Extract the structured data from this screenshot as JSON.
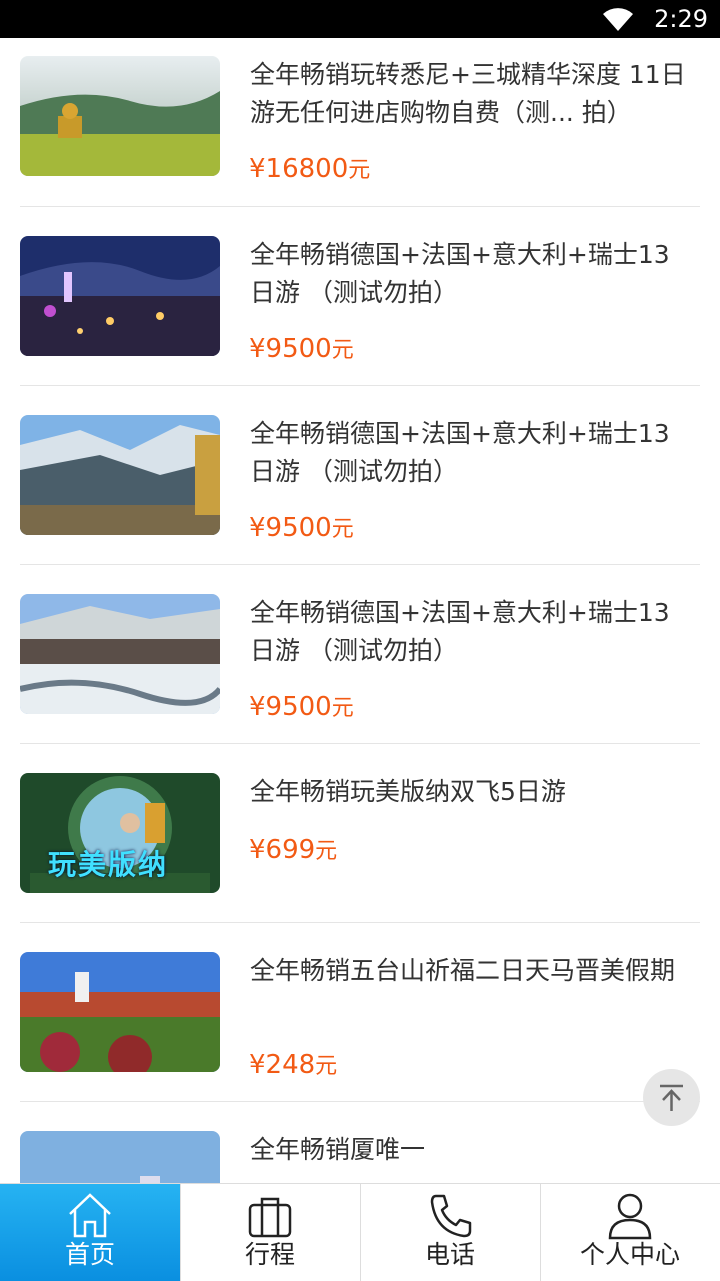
{
  "status_bar": {
    "time": "2:29",
    "wifi_icon": "wifi-icon"
  },
  "products": [
    {
      "title": "全年畅销玩转悉尼+三城精华深度 11日游无任何进店购物自费（测... 拍）",
      "price": "¥16800",
      "unit": "元"
    },
    {
      "title": "全年畅销德国+法国+意大利+瑞士13日游 （测试勿拍）",
      "price": "¥9500",
      "unit": "元"
    },
    {
      "title": "全年畅销德国+法国+意大利+瑞士13日游 （测试勿拍）",
      "price": "¥9500",
      "unit": "元"
    },
    {
      "title": "全年畅销德国+法国+意大利+瑞士13日游 （测试勿拍）",
      "price": "¥9500",
      "unit": "元"
    },
    {
      "title": "全年畅销玩美版纳双飞5日游",
      "price": "¥699",
      "unit": "元"
    },
    {
      "title": "全年畅销五台山祈福二日天马晋美假期",
      "price": "¥248",
      "unit": "元"
    },
    {
      "title": "全年畅销厦唯一",
      "price": "",
      "unit": ""
    }
  ],
  "thumb_caption": "玩美版纳",
  "back_to_top_icon": "arrow-up-to-top-icon",
  "tabs": [
    {
      "label": "首页",
      "icon": "home-icon",
      "active": true
    },
    {
      "label": "行程",
      "icon": "briefcase-icon",
      "active": false
    },
    {
      "label": "电话",
      "icon": "phone-icon",
      "active": false
    },
    {
      "label": "个人中心",
      "icon": "user-icon",
      "active": false
    }
  ],
  "colors": {
    "price": "#f25a14",
    "tab_active": "#1aa3ea"
  }
}
